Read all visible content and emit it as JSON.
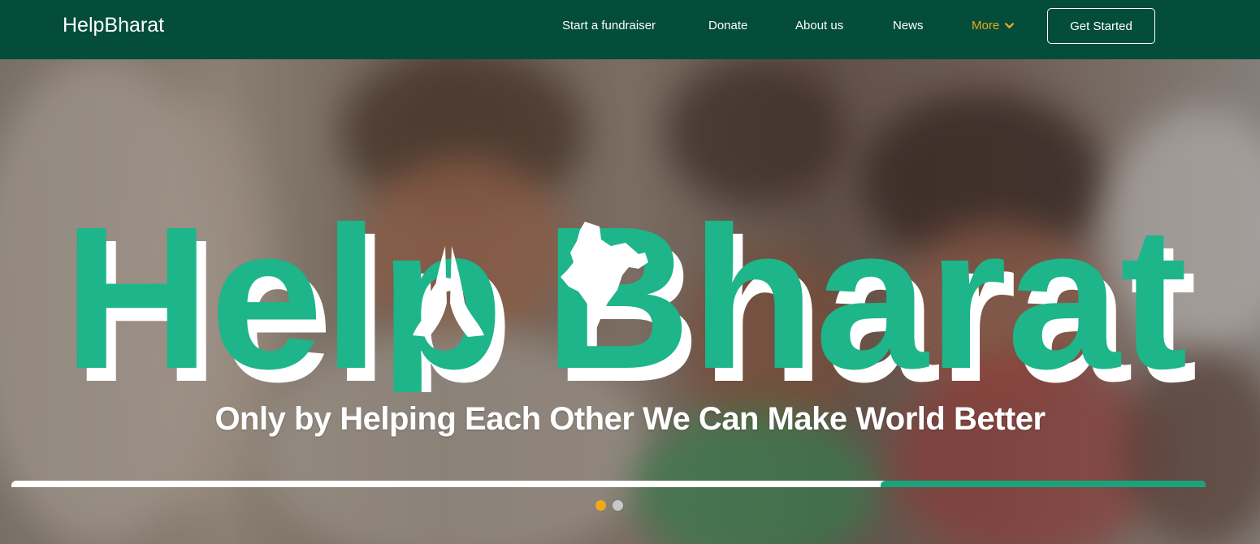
{
  "brand": {
    "name": "HelpBharat"
  },
  "nav": {
    "items": [
      {
        "label": "Start a fundraiser"
      },
      {
        "label": "Donate"
      },
      {
        "label": "About us"
      },
      {
        "label": "News"
      },
      {
        "label": "More"
      }
    ],
    "cta_label": "Get Started"
  },
  "hero": {
    "logo_word_1": "Help",
    "logo_word_2": "Bharat",
    "tagline": "Only by Helping Each Other We Can Make World Better",
    "slides_total": 2,
    "active_slide": 1
  },
  "colors": {
    "nav_bg": "#034d3a",
    "accent": "#f0a81a",
    "logo_green": "#1db589",
    "white": "#ffffff"
  },
  "icons": {
    "more_dropdown": "chevron-down-icon",
    "praying_hands": "namaste-hands-icon",
    "india_map": "india-map-icon"
  }
}
